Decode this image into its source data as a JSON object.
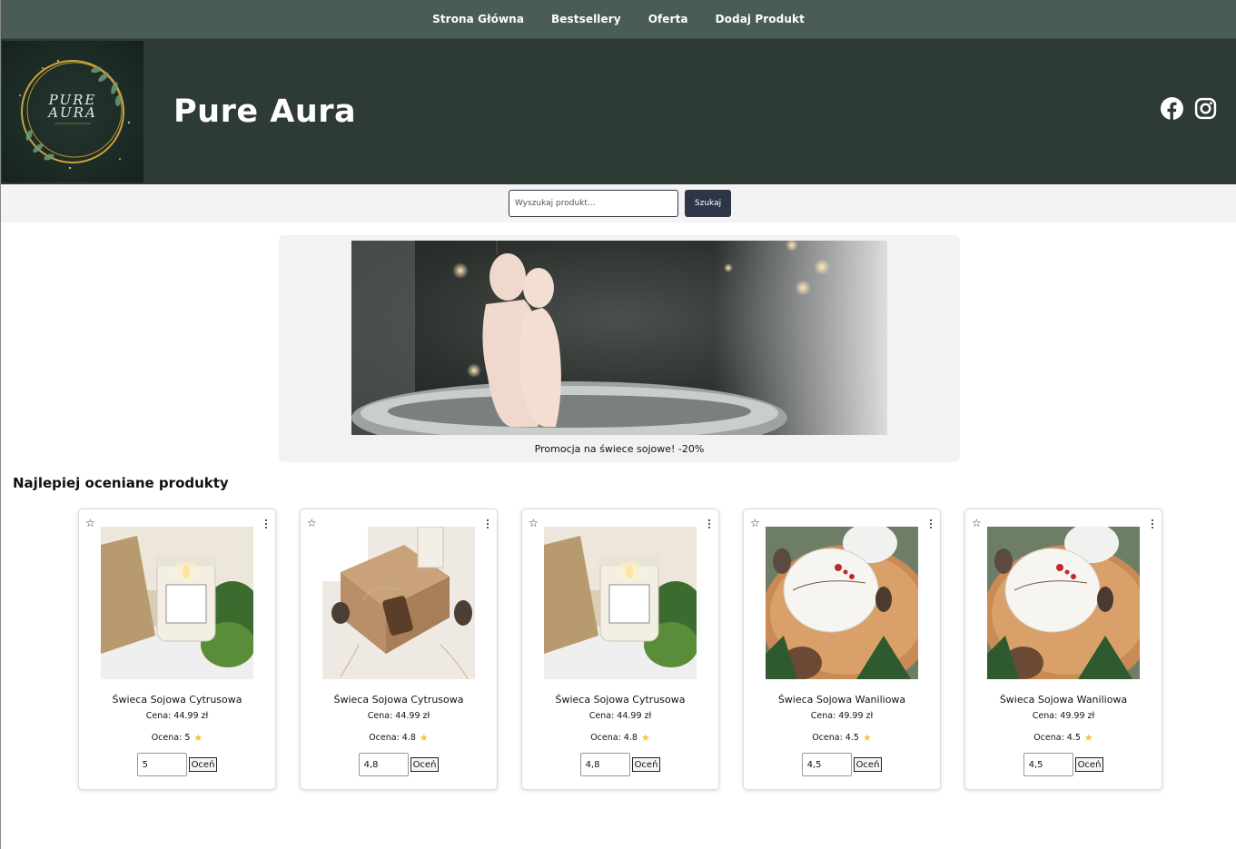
{
  "nav": {
    "items": [
      "Strona Główna",
      "Bestsellery",
      "Oferta",
      "Dodaj Produkt"
    ]
  },
  "header": {
    "brand": "Pure Aura",
    "logo_text_line1": "PURE",
    "logo_text_line2": "AURA",
    "social_icons": [
      "facebook-icon",
      "instagram-icon"
    ]
  },
  "search": {
    "placeholder": "Wyszukaj produkt...",
    "value": "",
    "button_label": "Szukaj"
  },
  "promo": {
    "caption": "Promocja na świece sojowe! -20%"
  },
  "section_title": "Najlepiej oceniane produkty",
  "products": [
    {
      "name": "Świeca Sojowa Cytrusowa",
      "price": "Cena: 44.99 zł",
      "rating_label": "Ocena: 5",
      "rating_input": "5",
      "rate_button": "Oceń",
      "image": "candle-jar-moss"
    },
    {
      "name": "Świeca Sojowa Cytrusowa",
      "price": "Cena: 44.99 zł",
      "rating_label": "Ocena: 4.8",
      "rating_input": "4,8",
      "rate_button": "Oceń",
      "image": "candle-giftbox"
    },
    {
      "name": "Świeca Sojowa Cytrusowa",
      "price": "Cena: 44.99 zł",
      "rating_label": "Ocena: 4.8",
      "rating_input": "4,8",
      "rate_button": "Oceń",
      "image": "candle-jar-moss"
    },
    {
      "name": "Świeca Sojowa Waniliowa",
      "price": "Cena: 49.99 zł",
      "rating_label": "Ocena: 4.5",
      "rating_input": "4,5",
      "rate_button": "Oceń",
      "image": "candle-tin-winter"
    },
    {
      "name": "Świeca Sojowa Waniliowa",
      "price": "Cena: 49.99 zł",
      "rating_label": "Ocena: 4.5",
      "rating_input": "4,5",
      "rate_button": "Oceń",
      "image": "candle-tin-winter"
    }
  ],
  "colors": {
    "nav_bg": "#4a5d55",
    "header_bg": "#2e3a34",
    "search_button": "#2e3547",
    "star": "#f4c430"
  }
}
